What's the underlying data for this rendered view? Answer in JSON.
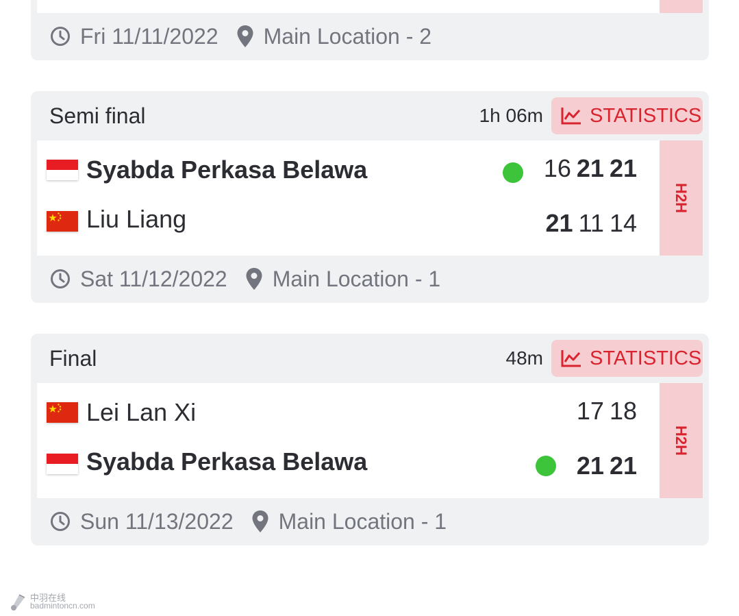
{
  "top_card": {
    "footer": {
      "date": "Fri 11/11/2022",
      "location": "Main Location - 2"
    }
  },
  "semi_final": {
    "round": "Semi final",
    "duration": "1h 06m",
    "statistics_label": "STATISTICS",
    "h2h_label": "H2H",
    "players": [
      {
        "name": "Syabda Perkasa Belawa",
        "country": "Indonesia",
        "winner": true,
        "serving": true,
        "scores": [
          "16",
          "21",
          "21"
        ],
        "won_games": [
          false,
          true,
          true
        ]
      },
      {
        "name": "Liu Liang",
        "country": "China",
        "winner": false,
        "serving": false,
        "scores": [
          "21",
          "11",
          "14"
        ],
        "won_games": [
          true,
          false,
          false
        ]
      }
    ],
    "footer": {
      "date": "Sat 11/12/2022",
      "location": "Main Location - 1"
    }
  },
  "final": {
    "round": "Final",
    "duration": "48m",
    "statistics_label": "STATISTICS",
    "h2h_label": "H2H",
    "players": [
      {
        "name": "Lei Lan Xi",
        "country": "China",
        "winner": false,
        "serving": false,
        "scores": [
          "17",
          "18"
        ],
        "won_games": [
          false,
          false
        ]
      },
      {
        "name": "Syabda Perkasa Belawa",
        "country": "Indonesia",
        "winner": true,
        "serving": true,
        "scores": [
          "21",
          "21"
        ],
        "won_games": [
          true,
          true
        ]
      }
    ],
    "footer": {
      "date": "Sun 11/13/2022",
      "location": "Main Location - 1"
    }
  },
  "watermark": {
    "line1": "中羽在线",
    "line2": "badmintoncn.com"
  },
  "colors": {
    "accent": "#d9232e",
    "accent_bg": "#f6cdd1",
    "serve_dot": "#3ec43a",
    "card_bg": "#f0f1f3",
    "muted_text": "#72757d"
  },
  "icons": {
    "clock": "clock-icon",
    "location": "map-pin-icon",
    "statistics": "line-chart-icon"
  }
}
